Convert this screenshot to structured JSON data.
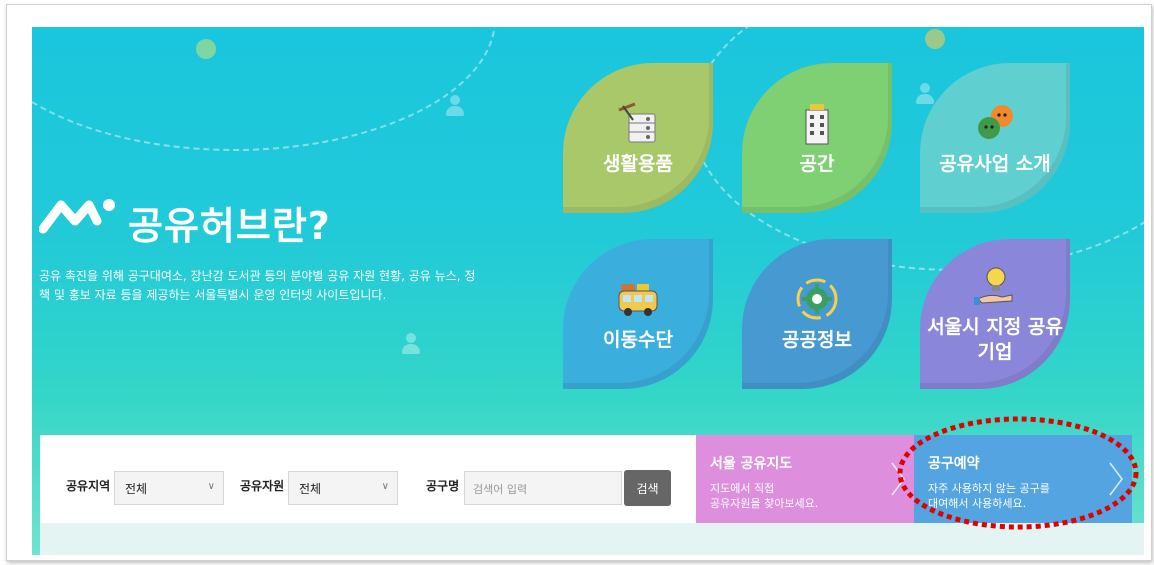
{
  "hero": {
    "title": "공유허브란?",
    "description": "공유 촉진을 위해 공구대여소, 장난감 도서관 등의 분야별 공유 자원 현황, 공유 뉴스, 정책 및 홍보 자료 등을 제공하는 서울특별시 운영 인터넷 사이트입니다."
  },
  "tiles": [
    {
      "label": "생활용품",
      "icon": "tools-shelf-icon",
      "color": "#a9c86a"
    },
    {
      "label": "공간",
      "icon": "building-icon",
      "color": "#7fcf73"
    },
    {
      "label": "공유사업 소개",
      "icon": "sharing-people-icon",
      "color": "#5fcfd0"
    },
    {
      "label": "이동수단",
      "icon": "van-icon",
      "color": "#3aaedc"
    },
    {
      "label": "공공정보",
      "icon": "gear-icon",
      "color": "#4699d1"
    },
    {
      "label": "서울시 지정 공유기업",
      "icon": "lightbulb-hand-icon",
      "color": "#8a86d9"
    }
  ],
  "search": {
    "region_label": "공유지역",
    "region_value": "전체",
    "resource_label": "공유자원",
    "resource_value": "전체",
    "tool_label": "공구명",
    "tool_placeholder": "검색어 입력",
    "button_label": "검색"
  },
  "cards": {
    "map": {
      "title": "서울 공유지도",
      "desc_line1": "지도에서 직접",
      "desc_line2": "공유자원을 찾아보세요.",
      "color": "#dd8fde"
    },
    "reserve": {
      "title": "공구예약",
      "desc_line1": "자주 사용하지 않는 공구를",
      "desc_line2": "대여해서 사용하세요.",
      "color": "#53a4e0"
    }
  },
  "colors": {
    "annotation": "#e00000",
    "accent": "#22cad8"
  }
}
